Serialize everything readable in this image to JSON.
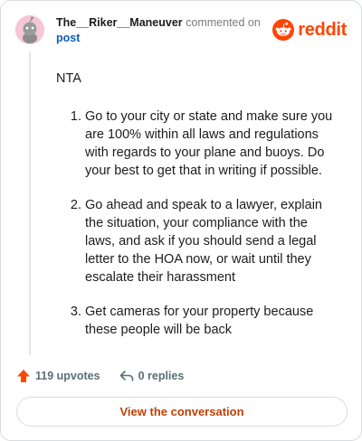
{
  "comment": {
    "username": "The__Riker__Maneuver",
    "action_text": "commented on",
    "post_link": "post",
    "intro": "NTA",
    "items": [
      "Go to your city or state and make sure you are 100% within all laws and regulations with regards to your plane and buoys. Do your best to get that in writing if possible.",
      "Go ahead and speak to a lawyer, explain the situation, your compliance with the laws, and ask if you should send a legal letter to the HOA now, or wait until they escalate their harassment",
      "Get cameras for your property because these people will be back"
    ]
  },
  "brand": {
    "name": "reddit",
    "icon": "reddit-logo-icon",
    "color": "#ff4500"
  },
  "actions": {
    "upvotes": "119 upvotes",
    "replies": "0 replies",
    "upvote_icon": "upvote-arrow-icon",
    "reply_icon": "reply-arrow-icon"
  },
  "view_button": {
    "label": "View the conversation"
  },
  "colors": {
    "accent": "#ff4500",
    "link": "#0b5fb8",
    "muted": "#576f76"
  }
}
